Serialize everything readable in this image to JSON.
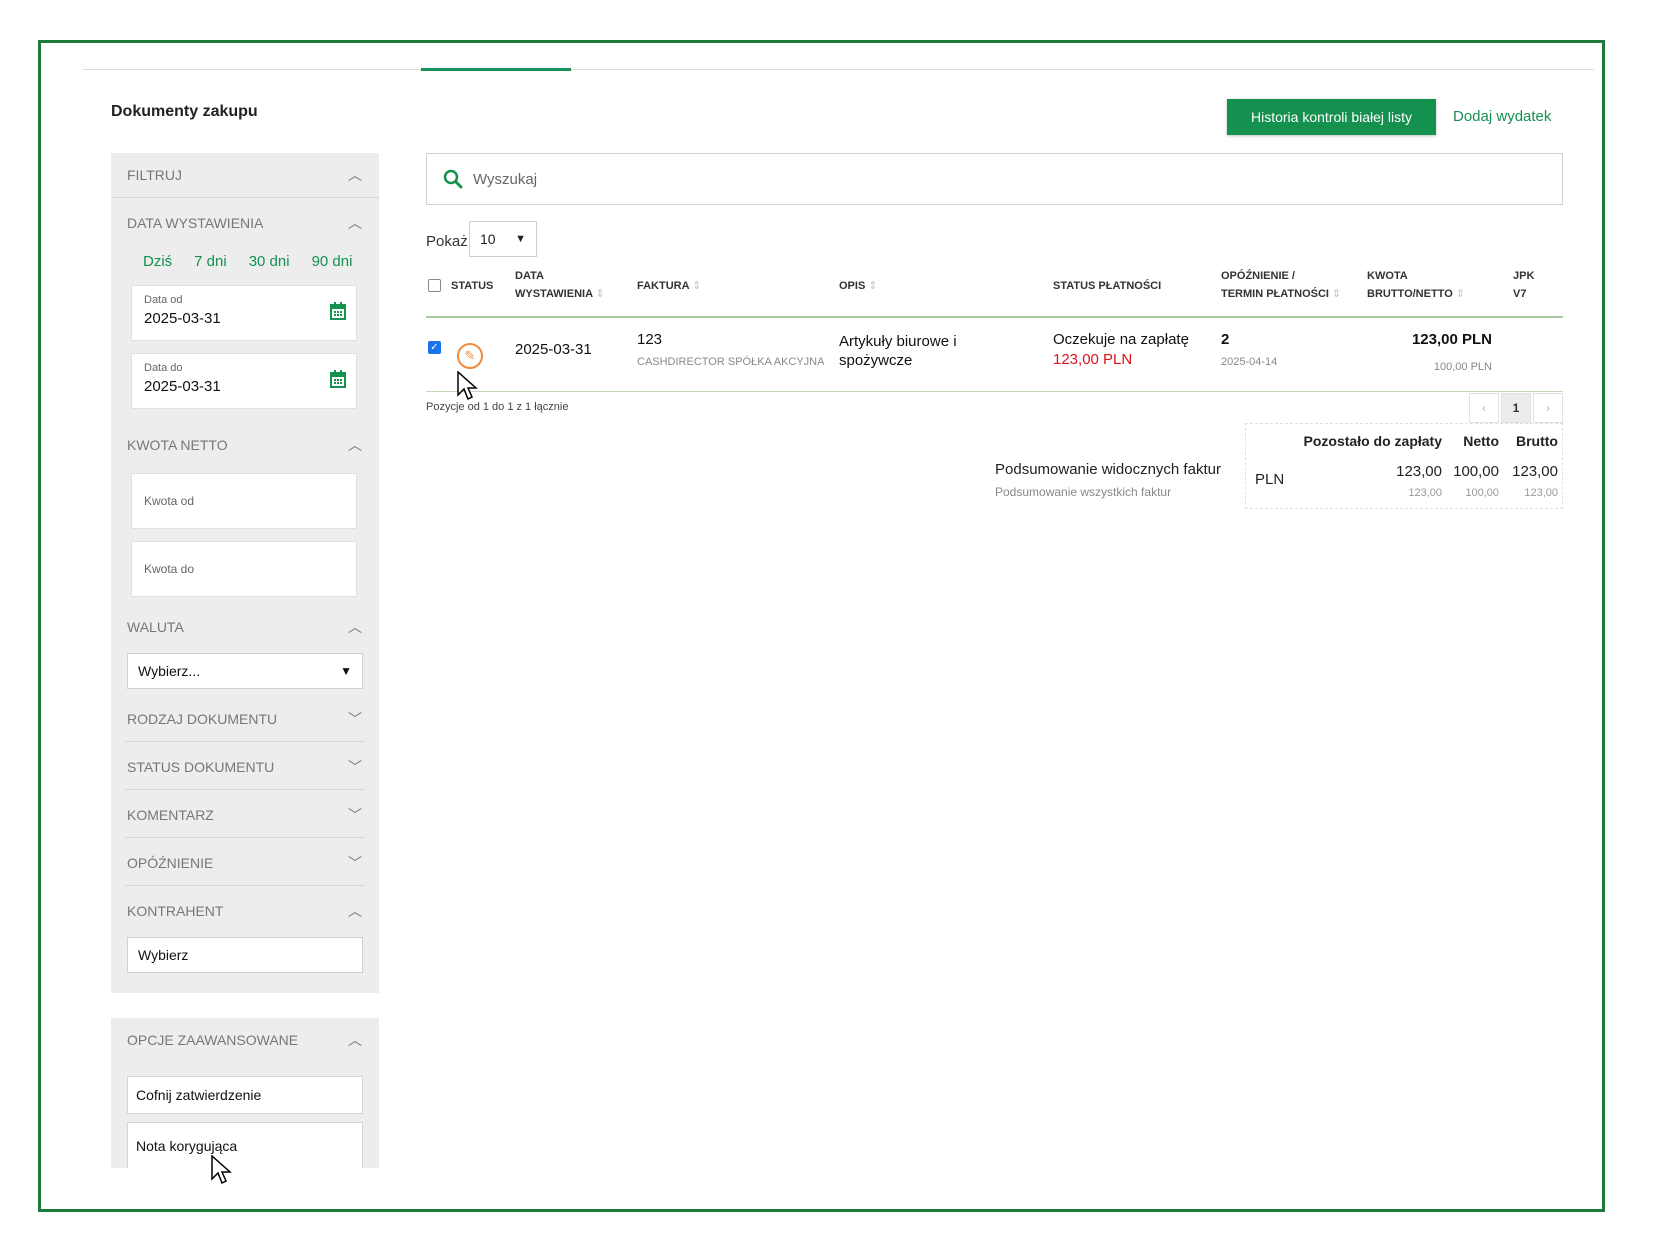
{
  "header": {
    "title": "Dokumenty zakupu",
    "history_button": "Historia kontroli białej listy",
    "add_link": "Dodaj wydatek"
  },
  "sidebar": {
    "filter_title": "FILTRUJ",
    "date_section": "DATA WYSTAWIENIA",
    "quick_ranges": [
      "Dziś",
      "7 dni",
      "30 dni",
      "90 dni"
    ],
    "date_from_label": "Data od",
    "date_from_value": "2025-03-31",
    "date_to_label": "Data do",
    "date_to_value": "2025-03-31",
    "amount_section": "KWOTA NETTO",
    "amount_from_placeholder": "Kwota od",
    "amount_to_placeholder": "Kwota do",
    "currency_section": "WALUTA",
    "currency_value": "Wybierz...",
    "doc_type_section": "RODZAJ DOKUMENTU",
    "doc_status_section": "STATUS DOKUMENTU",
    "comment_section": "KOMENTARZ",
    "delay_section": "OPÓŹNIENIE",
    "contractor_section": "KONTRAHENT",
    "contractor_value": "Wybierz",
    "advanced_section": "OPCJE ZAAWANSOWANE",
    "advanced_options": [
      "Cofnij zatwierdzenie",
      "Nota korygująca"
    ]
  },
  "search": {
    "placeholder": "Wyszukaj"
  },
  "table": {
    "show_label": "Pokaż",
    "page_size": "10",
    "columns": {
      "status": "STATUS",
      "date_line1": "DATA",
      "date_line2": "WYSTAWIENIA",
      "invoice": "FAKTURA",
      "description": "OPIS",
      "payment_status": "STATUS PŁATNOŚCI",
      "delay_line1": "OPÓŹNIENIE /",
      "delay_line2": "TERMIN PŁATNOŚCI",
      "amount_line1": "KWOTA",
      "amount_line2": "BRUTTO/NETTO",
      "jpk_line1": "JPK",
      "jpk_line2": "V7"
    },
    "rows": [
      {
        "date": "2025-03-31",
        "invoice": "123",
        "contractor": "CASHDIRECTOR SPÓŁKA AKCYJNA",
        "description_line1": "Artykuły biurowe i",
        "description_line2": "spożywcze",
        "payment_status": "Oczekuje na zapłatę",
        "payment_amount": "123,00 PLN",
        "delay": "2",
        "due_date": "2025-04-14",
        "gross": "123,00 PLN",
        "net": "100,00 PLN"
      }
    ],
    "pager_info": "Pozycje od 1 do 1 z 1 łącznie",
    "current_page": "1",
    "prev": "‹",
    "next": "›"
  },
  "summary": {
    "visible_label": "Podsumowanie widocznych faktur",
    "all_label": "Podsumowanie wszystkich faktur",
    "headers": [
      "Pozostało do zapłaty",
      "Netto",
      "Brutto"
    ],
    "currency": "PLN",
    "visible": [
      "123,00",
      "100,00",
      "123,00"
    ],
    "all": [
      "123,00",
      "100,00",
      "123,00"
    ]
  },
  "colors": {
    "accent": "#14904f",
    "frame": "#1e7a3c",
    "alert": "#d9141a",
    "status_icon": "#f08a3c"
  }
}
